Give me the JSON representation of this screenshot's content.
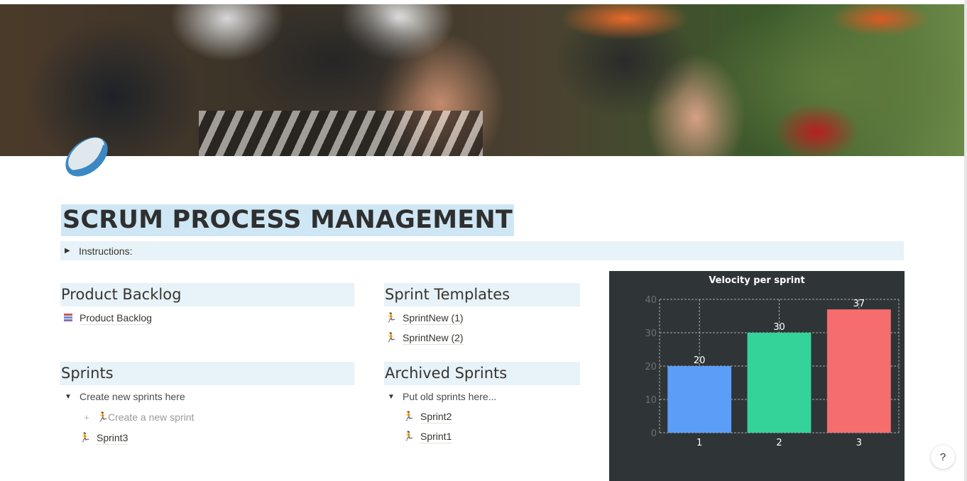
{
  "page": {
    "title": "SCRUM PROCESS MANAGEMENT",
    "icon": "rugby-ball-icon",
    "cover": "rugby-scrum-photo"
  },
  "instructions": {
    "label": "Instructions:",
    "state": "collapsed"
  },
  "product_backlog": {
    "heading": "Product Backlog",
    "items": [
      {
        "icon": "books-icon",
        "label": "Product Backlog"
      }
    ]
  },
  "sprint_templates": {
    "heading": "Sprint Templates",
    "items": [
      {
        "icon": "runner-icon",
        "label": "SprintNew (1)"
      },
      {
        "icon": "runner-icon",
        "label": "SprintNew (2)"
      }
    ]
  },
  "sprints": {
    "heading": "Sprints",
    "toggle_label": "Create new sprints here",
    "create_button": "Create a new sprint",
    "items": [
      {
        "icon": "runner-icon",
        "label": "Sprint3"
      }
    ]
  },
  "archived_sprints": {
    "heading": "Archived Sprints",
    "toggle_label": "Put old sprints here...",
    "items": [
      {
        "icon": "runner-icon",
        "label": "Sprint2"
      },
      {
        "icon": "runner-icon",
        "label": "Sprint1"
      }
    ]
  },
  "help_button": "?",
  "chart_data": {
    "type": "bar",
    "title": "Velocity per sprint",
    "categories": [
      "1",
      "2",
      "3"
    ],
    "values": [
      20,
      30,
      37
    ],
    "colors": [
      "#5b9ef7",
      "#34d399",
      "#f56d6d"
    ],
    "xlabel": "",
    "ylabel": "",
    "ylim": [
      0,
      40
    ],
    "yticks": [
      0,
      10,
      20,
      30,
      40
    ],
    "grid": true,
    "data_labels": true
  }
}
